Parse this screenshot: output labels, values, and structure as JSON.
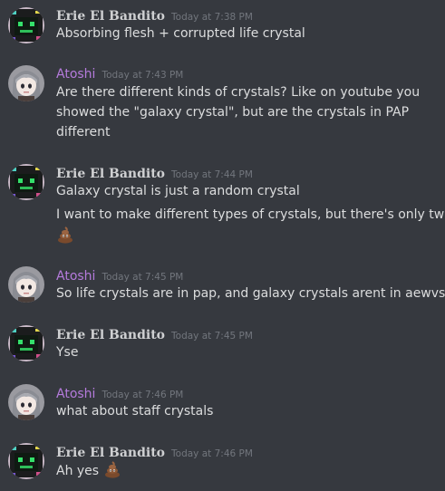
{
  "messages": [
    {
      "author": "Erie El Bandito",
      "author_style": "erie",
      "avatar_icon": "green-robot-face-avatar",
      "timestamp": "Today at 7:38 PM",
      "lines": [
        "Absorbing flesh + corrupted life crystal"
      ]
    },
    {
      "author": "Atoshi",
      "author_style": "atoshi",
      "avatar_icon": "anime-girl-avatar",
      "timestamp": "Today at 7:43 PM",
      "lines": [
        "Are there different kinds of crystals? Like on youtube you",
        "showed the \"galaxy crystal\", but are the crystals in PAP",
        "different"
      ]
    },
    {
      "author": "Erie El Bandito",
      "author_style": "erie",
      "avatar_icon": "green-robot-face-avatar",
      "timestamp": "Today at 7:44 PM",
      "lines": [
        "Galaxy crystal is just a random crystal",
        "I want to make different types of crystals, but there's only two"
      ],
      "trailing_emoji": "poop-emoji"
    },
    {
      "author": "Atoshi",
      "author_style": "atoshi",
      "avatar_icon": "anime-girl-avatar",
      "timestamp": "Today at 7:45 PM",
      "lines": [
        "So life crystals are in pap, and galaxy crystals arent in aewvs"
      ]
    },
    {
      "author": "Erie El Bandito",
      "author_style": "erie",
      "avatar_icon": "green-robot-face-avatar",
      "timestamp": "Today at 7:45 PM",
      "lines": [
        "Yse"
      ]
    },
    {
      "author": "Atoshi",
      "author_style": "atoshi",
      "avatar_icon": "anime-girl-avatar",
      "timestamp": "Today at 7:46 PM",
      "lines": [
        "what about staff crystals"
      ]
    },
    {
      "author": "Erie El Bandito",
      "author_style": "erie",
      "avatar_icon": "green-robot-face-avatar",
      "timestamp": "Today at 7:46 PM",
      "lines": [
        "Ah yes"
      ],
      "inline_emoji": "poop-emoji"
    }
  ],
  "colors": {
    "background": "#36393f",
    "erie_name": "#cfd0d2",
    "atoshi_name": "#b57bdc",
    "timestamp": "#72767d",
    "message_text": "#dcddde"
  }
}
